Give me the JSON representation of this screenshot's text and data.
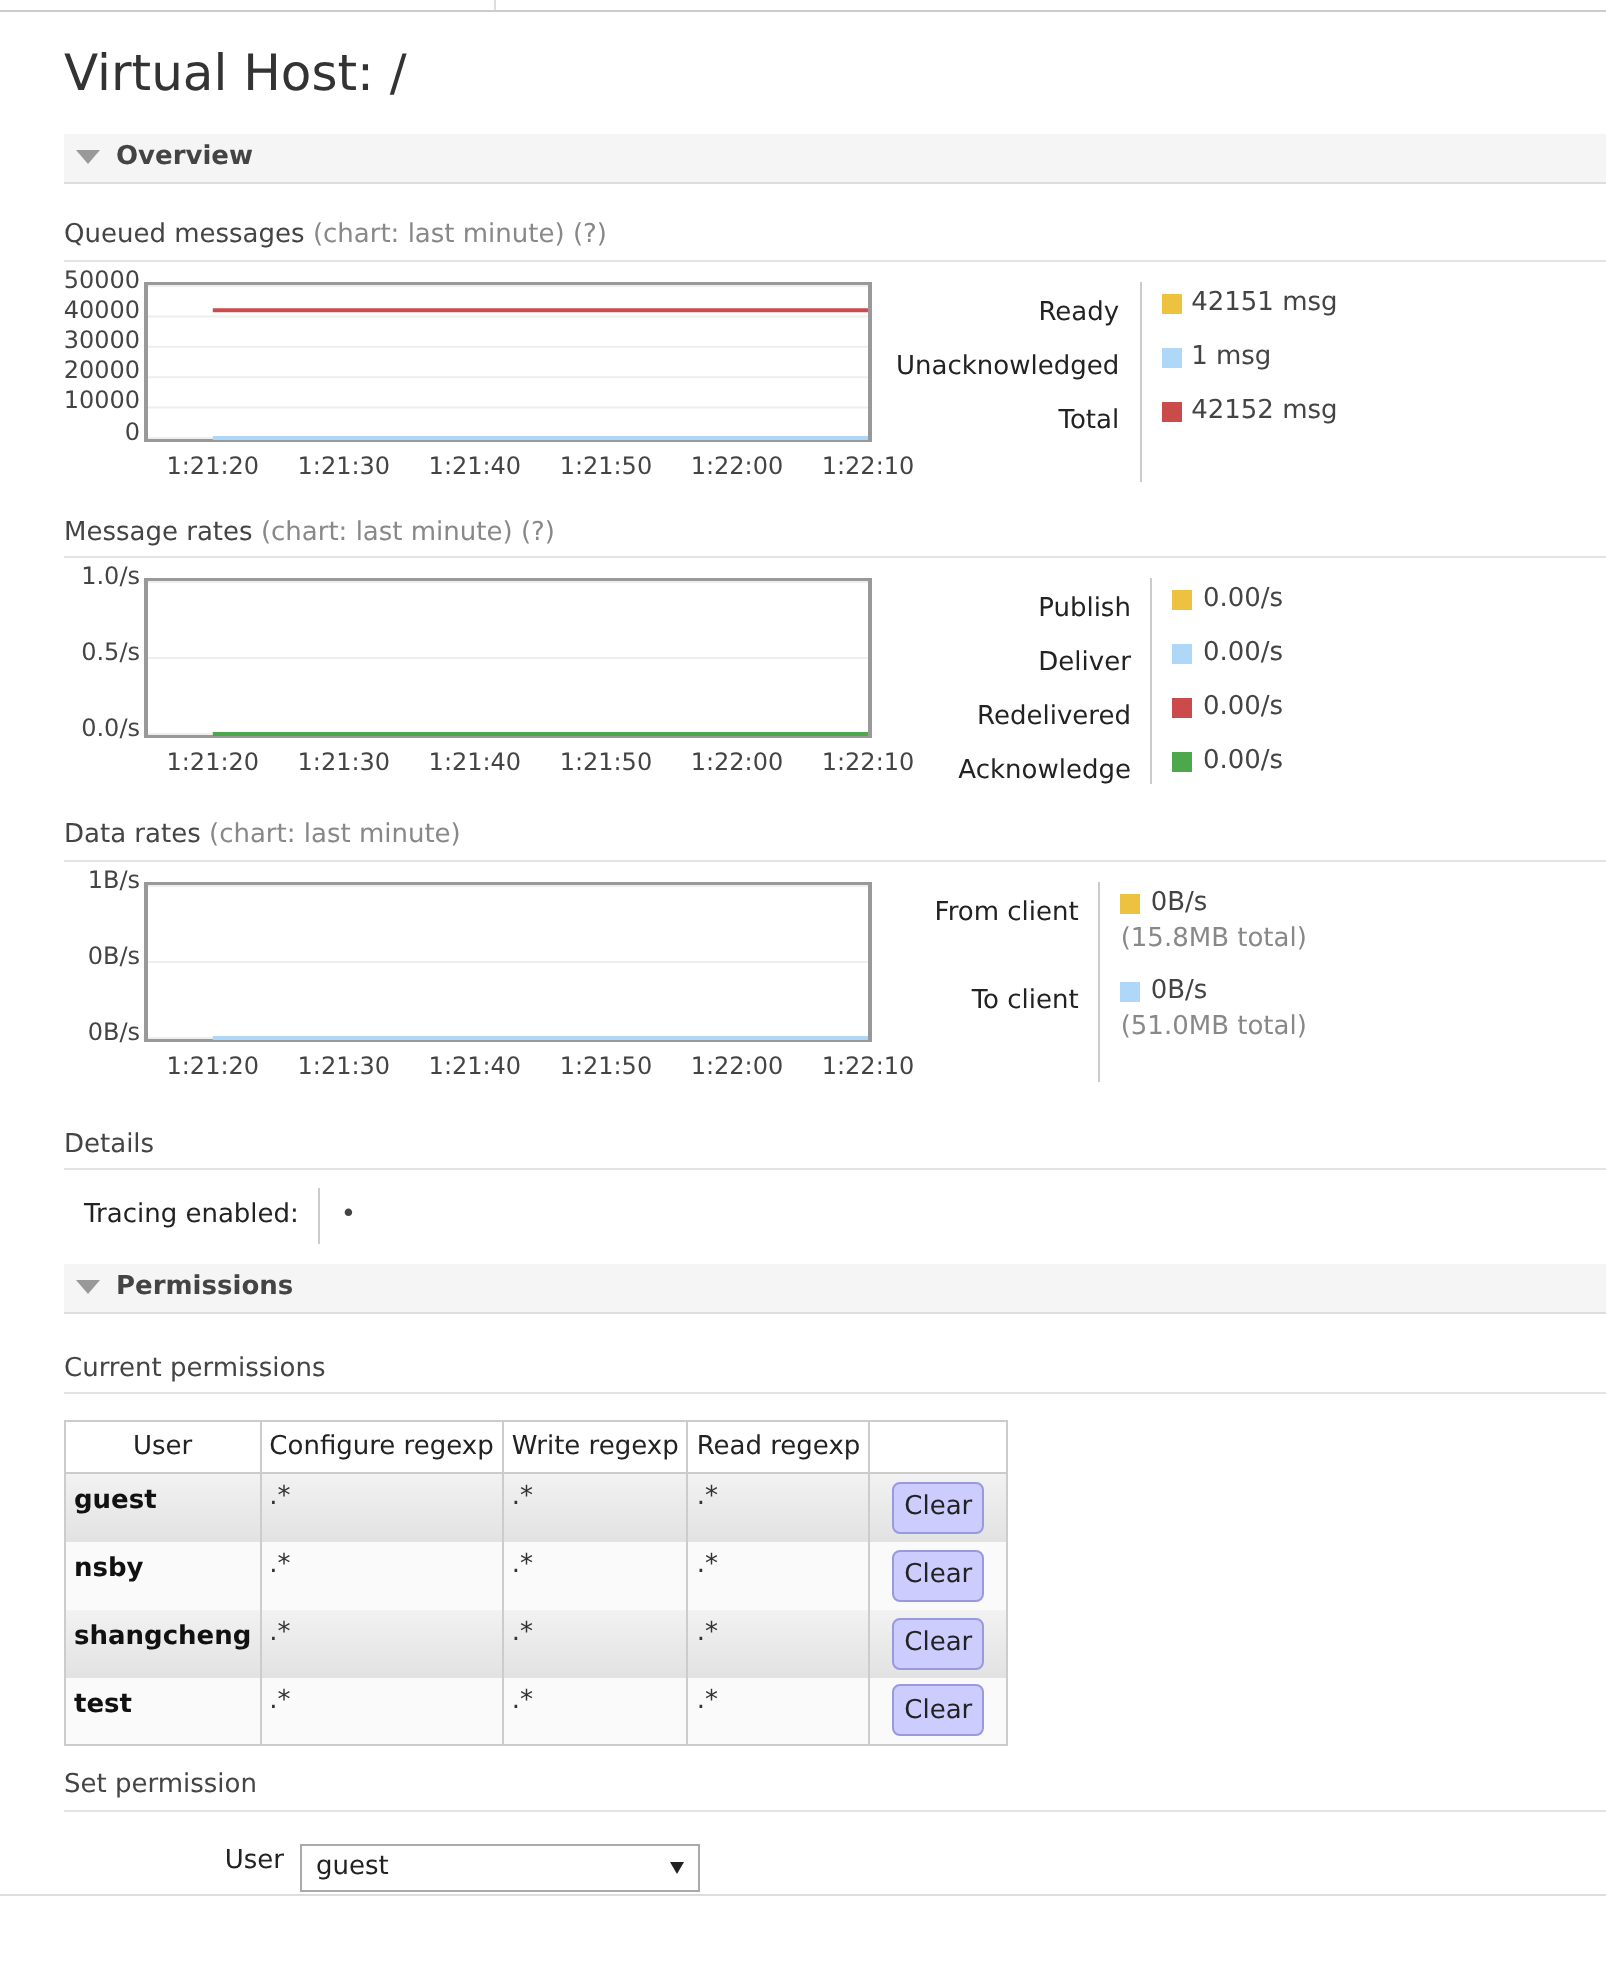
{
  "title": "Virtual Host: /",
  "overview": {
    "title": "Overview",
    "expanded": true,
    "charts": [
      {
        "title": "Queued messages",
        "note": "(chart: last minute) (?)",
        "chart_data": {
          "type": "line",
          "grid": true,
          "x": [
            "1:21:20",
            "1:21:30",
            "1:21:40",
            "1:21:50",
            "1:22:00",
            "1:22:10"
          ],
          "ylim": [
            0,
            50000
          ],
          "yticks": [
            0,
            10000,
            20000,
            30000,
            40000,
            50000
          ],
          "series": [
            {
              "color": "#afd8f8",
              "values": [
                0,
                0,
                0,
                0,
                0,
                0
              ]
            },
            {
              "color": "#cb4b4b",
              "values": [
                42000,
                42000,
                42000,
                42000,
                42000,
                42000
              ]
            }
          ]
        },
        "legend": [
          {
            "label": "Ready",
            "color": "#edc240",
            "value": "42151 msg"
          },
          {
            "label": "Unacknowledged",
            "color": "#afd8f8",
            "value": "1 msg"
          },
          {
            "label": "Total",
            "color": "#cb4b4b",
            "value": "42152 msg"
          }
        ]
      },
      {
        "title": "Message rates",
        "note": "(chart: last minute) (?)",
        "chart_data": {
          "type": "line",
          "grid": true,
          "x": [
            "1:21:20",
            "1:21:30",
            "1:21:40",
            "1:21:50",
            "1:22:00",
            "1:22:10"
          ],
          "ylim": [
            0,
            1
          ],
          "yticks": [
            {
              "value": 0,
              "label": "0.0/s"
            },
            {
              "value": 0.5,
              "label": "0.5/s"
            },
            {
              "value": 1,
              "label": "1.0/s"
            }
          ],
          "series": [
            {
              "color": "#4da74d",
              "values": [
                0,
                0,
                0,
                0,
                0,
                0
              ]
            }
          ]
        },
        "legend": [
          {
            "label": "Publish",
            "color": "#edc240",
            "value": "0.00/s"
          },
          {
            "label": "Deliver",
            "color": "#afd8f8",
            "value": "0.00/s"
          },
          {
            "label": "Redelivered",
            "color": "#cb4b4b",
            "value": "0.00/s"
          },
          {
            "label": "Acknowledge",
            "color": "#4da74d",
            "value": "0.00/s"
          }
        ]
      },
      {
        "title": "Data rates",
        "note": "(chart: last minute)",
        "chart_data": {
          "type": "line",
          "grid": true,
          "x": [
            "1:21:20",
            "1:21:30",
            "1:21:40",
            "1:21:50",
            "1:22:00",
            "1:22:10"
          ],
          "ylim": [
            0,
            1
          ],
          "yticks": [
            {
              "value": 0,
              "label": "0B/s"
            },
            {
              "value": 0.5,
              "label": "0B/s"
            },
            {
              "value": 1,
              "label": "1B/s"
            }
          ],
          "series": [
            {
              "color": "#afd8f8",
              "values": [
                0,
                0,
                0,
                0,
                0,
                0
              ]
            }
          ]
        },
        "legend": [
          {
            "label": "From client",
            "color": "#edc240",
            "value": "0B/s",
            "sub": "(15.8MB total)"
          },
          {
            "label": "To client",
            "color": "#afd8f8",
            "value": "0B/s",
            "sub": "(51.0MB total)"
          }
        ]
      }
    ],
    "details": {
      "title": "Details",
      "rows": [
        {
          "label": "Tracing enabled:",
          "value": "•"
        }
      ]
    }
  },
  "permissions": {
    "title": "Permissions",
    "expanded": true,
    "current_title": "Current permissions",
    "columns": [
      "User",
      "Configure regexp",
      "Write regexp",
      "Read regexp"
    ],
    "rows": [
      {
        "user": "guest",
        "configure": ".*",
        "write": ".*",
        "read": ".*",
        "action": "Clear"
      },
      {
        "user": "nsby",
        "configure": ".*",
        "write": ".*",
        "read": ".*",
        "action": "Clear"
      },
      {
        "user": "shangcheng",
        "configure": ".*",
        "write": ".*",
        "read": ".*",
        "action": "Clear"
      },
      {
        "user": "test",
        "configure": ".*",
        "write": ".*",
        "read": ".*",
        "action": "Clear"
      }
    ],
    "set_title": "Set permission",
    "user_field": {
      "label": "User",
      "value": "guest"
    }
  }
}
